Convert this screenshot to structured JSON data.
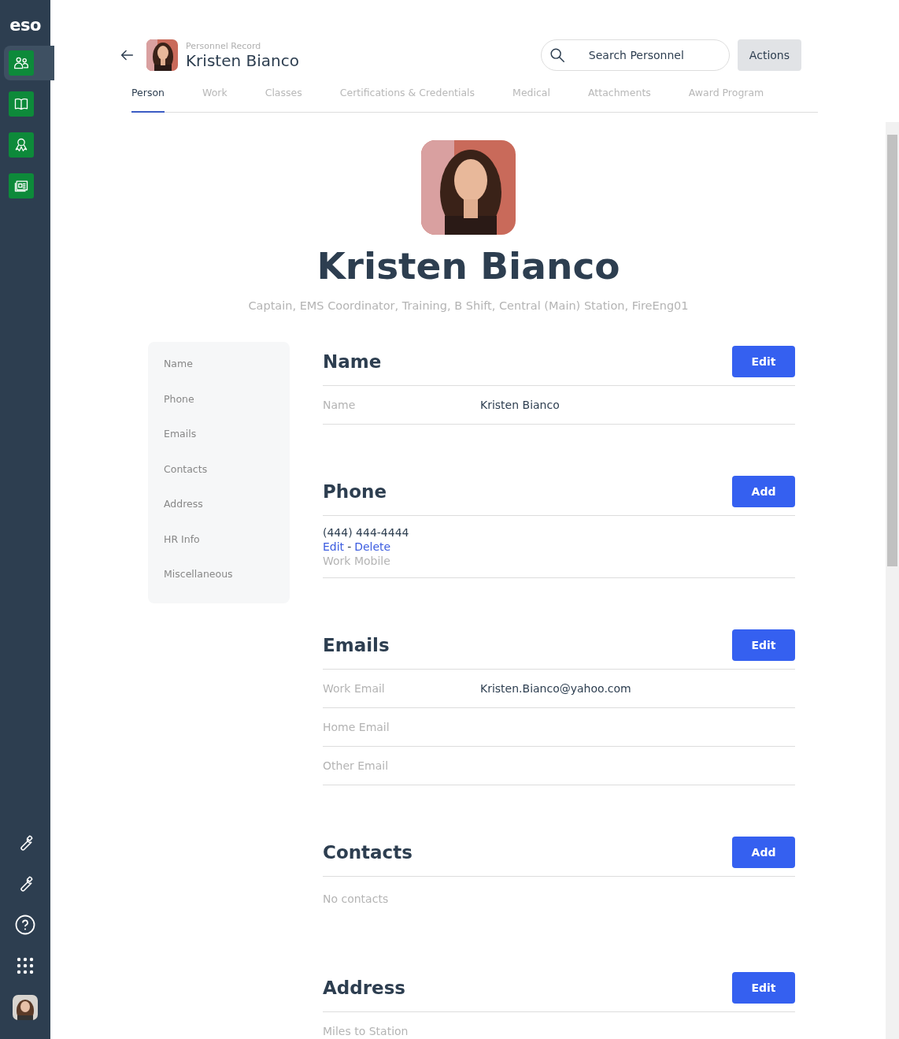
{
  "sidebar": {
    "logo": "eso",
    "apps": [
      {
        "selected": true
      },
      {
        "selected": false
      },
      {
        "selected": false
      },
      {
        "selected": false
      }
    ]
  },
  "header": {
    "eyebrow": "Personnel Record",
    "name": "Kristen Bianco",
    "search": {
      "placeholder": "Search Personnel"
    },
    "actions": "Actions"
  },
  "tabs": [
    {
      "label": "Person",
      "selected": true
    },
    {
      "label": "Work",
      "selected": false
    },
    {
      "label": "Classes",
      "selected": false
    },
    {
      "label": "Certifications & Credentials",
      "selected": false
    },
    {
      "label": "Medical",
      "selected": false
    },
    {
      "label": "Attachments",
      "selected": false
    },
    {
      "label": "Award Program",
      "selected": false
    }
  ],
  "profile": {
    "name": "Kristen Bianco",
    "subtitle": "Captain, EMS Coordinator, Training, B Shift, Central (Main) Station, FireEng01"
  },
  "section_nav": [
    "Name",
    "Phone",
    "Emails",
    "Contacts",
    "Address",
    "HR Info",
    "Miscellaneous"
  ],
  "sections": [
    {
      "kind": "fields",
      "title": "Name",
      "button": "Edit",
      "rows": [
        {
          "label": "Name",
          "value": "Kristen Bianco"
        }
      ]
    },
    {
      "kind": "phone",
      "title": "Phone",
      "button": "Add",
      "number": "(444) 444-4444",
      "edit": "Edit",
      "separator": "-",
      "delete": "Delete",
      "type": "Work Mobile"
    },
    {
      "kind": "fields",
      "title": "Emails",
      "button": "Edit",
      "rows": [
        {
          "label": "Work Email",
          "value": "Kristen.Bianco@yahoo.com"
        },
        {
          "label": "Home Email"
        },
        {
          "label": "Other Email"
        }
      ]
    },
    {
      "kind": "empty",
      "title": "Contacts",
      "button": "Add",
      "note": "No contacts"
    },
    {
      "kind": "fields",
      "title": "Address",
      "button": "Edit",
      "rows": [
        {
          "label": "Miles to Station"
        }
      ]
    }
  ]
}
